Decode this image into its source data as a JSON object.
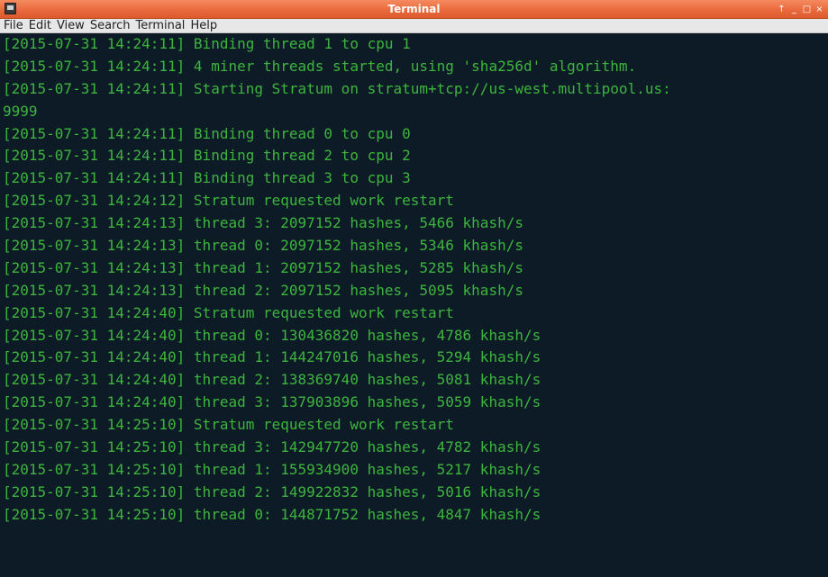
{
  "window": {
    "title": "Terminal",
    "controls": {
      "maximize_glyph": "↑",
      "minimize_glyph": "_",
      "restore_glyph": "□",
      "close_glyph": "×"
    }
  },
  "menu": {
    "items": [
      "File",
      "Edit",
      "View",
      "Search",
      "Terminal",
      "Help"
    ]
  },
  "terminal": {
    "lines": [
      "[2015-07-31 14:24:11] Binding thread 1 to cpu 1",
      "[2015-07-31 14:24:11] 4 miner threads started, using 'sha256d' algorithm.",
      "[2015-07-31 14:24:11] Starting Stratum on stratum+tcp://us-west.multipool.us:",
      "9999",
      "[2015-07-31 14:24:11] Binding thread 0 to cpu 0",
      "[2015-07-31 14:24:11] Binding thread 2 to cpu 2",
      "[2015-07-31 14:24:11] Binding thread 3 to cpu 3",
      "[2015-07-31 14:24:12] Stratum requested work restart",
      "[2015-07-31 14:24:13] thread 3: 2097152 hashes, 5466 khash/s",
      "[2015-07-31 14:24:13] thread 0: 2097152 hashes, 5346 khash/s",
      "[2015-07-31 14:24:13] thread 1: 2097152 hashes, 5285 khash/s",
      "[2015-07-31 14:24:13] thread 2: 2097152 hashes, 5095 khash/s",
      "[2015-07-31 14:24:40] Stratum requested work restart",
      "[2015-07-31 14:24:40] thread 0: 130436820 hashes, 4786 khash/s",
      "[2015-07-31 14:24:40] thread 1: 144247016 hashes, 5294 khash/s",
      "[2015-07-31 14:24:40] thread 2: 138369740 hashes, 5081 khash/s",
      "[2015-07-31 14:24:40] thread 3: 137903896 hashes, 5059 khash/s",
      "[2015-07-31 14:25:10] Stratum requested work restart",
      "[2015-07-31 14:25:10] thread 3: 142947720 hashes, 4782 khash/s",
      "[2015-07-31 14:25:10] thread 1: 155934900 hashes, 5217 khash/s",
      "[2015-07-31 14:25:10] thread 2: 149922832 hashes, 5016 khash/s",
      "[2015-07-31 14:25:10] thread 0: 144871752 hashes, 4847 khash/s"
    ]
  },
  "colors": {
    "titlebar": "#e8683c",
    "terminal_background": "#0d1b27",
    "terminal_text": "#3db53d",
    "menubar": "#e7e7e7"
  }
}
